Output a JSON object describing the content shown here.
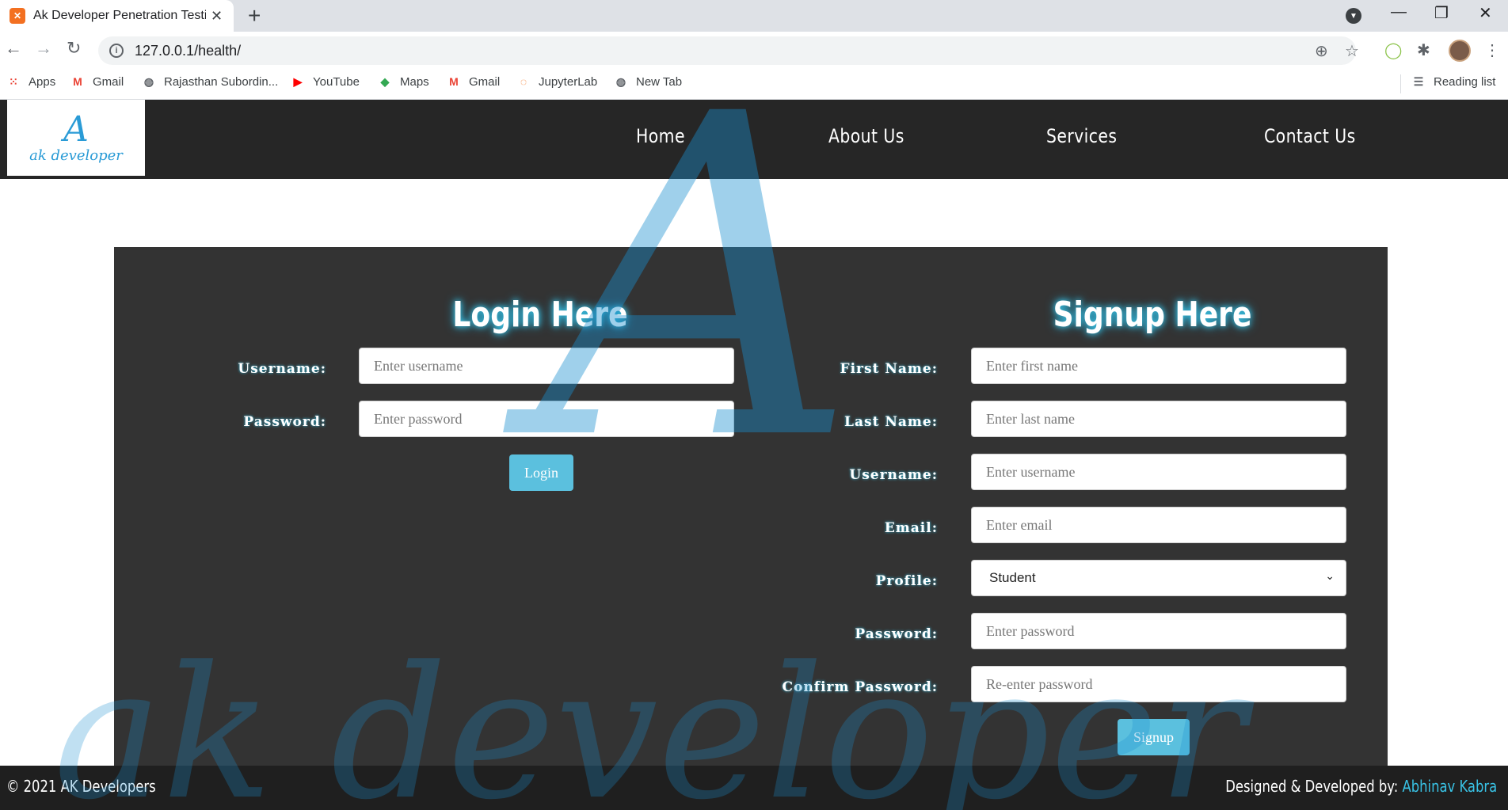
{
  "browser": {
    "tab_title": "Ak Developer Penetration Testing",
    "url": "127.0.0.1/health/",
    "bookmarks": [
      {
        "label": "Apps",
        "icon": "apps-grid-icon"
      },
      {
        "label": "Gmail",
        "icon": "gmail-icon"
      },
      {
        "label": "Rajasthan Subordin...",
        "icon": "globe-icon"
      },
      {
        "label": "YouTube",
        "icon": "youtube-icon"
      },
      {
        "label": "Maps",
        "icon": "maps-icon"
      },
      {
        "label": "Gmail",
        "icon": "gmail-icon"
      },
      {
        "label": "JupyterLab",
        "icon": "jupyter-icon"
      },
      {
        "label": "New Tab",
        "icon": "globe-icon"
      }
    ],
    "reading_list": "Reading list"
  },
  "site": {
    "logo_mark": "A",
    "logo_text": "ak developer",
    "nav": [
      "Home",
      "About Us",
      "Services",
      "Contact Us"
    ],
    "watermark_mark": "A",
    "watermark_text": "ak developer"
  },
  "login": {
    "title": "Login Here",
    "username_label": "Username:",
    "username_placeholder": "Enter username",
    "password_label": "Password:",
    "password_placeholder": "Enter password",
    "button": "Login"
  },
  "signup": {
    "title": "Signup Here",
    "first_name_label": "First Name:",
    "first_name_placeholder": "Enter first name",
    "last_name_label": "Last Name:",
    "last_name_placeholder": "Enter last name",
    "username_label": "Username:",
    "username_placeholder": "Enter username",
    "email_label": "Email:",
    "email_placeholder": "Enter email",
    "profile_label": "Profile:",
    "profile_value": "Student",
    "password_label": "Password:",
    "password_placeholder": "Enter password",
    "confirm_label": "Confirm Password:",
    "confirm_placeholder": "Re-enter password",
    "button": "Signup"
  },
  "footer": {
    "copyright": "© 2021 AK Developers",
    "credit_prefix": "Designed & Developed by:",
    "credit_author": "Abhinav Kabra"
  },
  "colors": {
    "nav_bg": "#262626",
    "panel_bg": "#333333",
    "accent": "#5bc0de",
    "glow": "#39c3e6"
  }
}
